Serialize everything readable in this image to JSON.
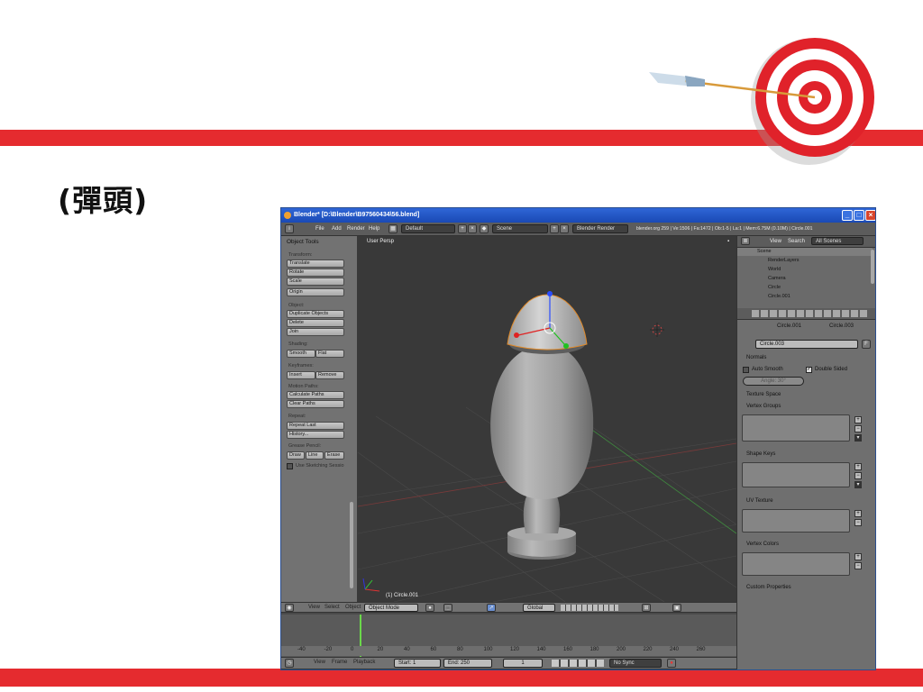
{
  "slide": {
    "heading": "(彈頭)",
    "colors": {
      "accent_red": "#e52b2f",
      "target_red": "#e0222a"
    }
  },
  "window": {
    "title": "Blender* [D:\\Blender\\B97560434\\56.blend]",
    "controls": {
      "minimize": "_",
      "maximize": "□",
      "close": "×"
    }
  },
  "menubar": {
    "menus": [
      "File",
      "Add",
      "Render",
      "Help"
    ],
    "screen_layout": "Default",
    "scene": "Scene",
    "render_engine": "Blender Render",
    "stats": "blender.org 259 | Ve:1506 | Fa:1472 | Ob:1-5 | La:1 | Mem:6.75M (0.10M) | Circle.001"
  },
  "tool_shelf": {
    "title": "Object Tools",
    "transform_label": "Transform:",
    "translate": "Translate",
    "rotate": "Rotate",
    "scale": "Scale",
    "origin": "Origin",
    "object_label": "Object:",
    "duplicate": "Duplicate Objects",
    "delete": "Delete",
    "join": "Join",
    "shading_label": "Shading:",
    "smooth": "Smooth",
    "flat": "Flat",
    "keyframes_label": "Keyframes:",
    "insert": "Insert",
    "remove": "Remove",
    "motion_label": "Motion Paths:",
    "calculate_paths": "Calculate Paths",
    "clear_paths": "Clear Paths",
    "repeat_label": "Repeat:",
    "repeat_last": "Repeat Last",
    "history": "History...",
    "grease_label": "Grease Pencil:",
    "draw": "Draw",
    "line": "Line",
    "erase": "Erase",
    "sketching": "Use Sketching Sessio"
  },
  "viewport": {
    "view_name": "User Persp",
    "object_label": "(1) Circle.001"
  },
  "viewport_header": {
    "menus": [
      "View",
      "Select",
      "Object"
    ],
    "mode": "Object Mode",
    "orientation": "Global"
  },
  "timeline": {
    "ticks": [
      "-40",
      "-20",
      "0",
      "20",
      "40",
      "60",
      "80",
      "100",
      "120",
      "140",
      "160",
      "180",
      "200",
      "220",
      "240",
      "260"
    ],
    "current_frame_tick": "0"
  },
  "timeline_header": {
    "menus": [
      "View",
      "Frame",
      "Playback"
    ],
    "start": "Start: 1",
    "end": "End: 250",
    "frame": "1",
    "sync": "No Sync"
  },
  "outliner": {
    "menus": [
      "View",
      "Search"
    ],
    "filter": "All Scenes",
    "items": [
      "Scene",
      "RenderLayers",
      "World",
      "Camera",
      "Circle",
      "Circle.001"
    ]
  },
  "properties": {
    "breadcrumb_object": "Circle.001",
    "breadcrumb_mesh": "Circle.003",
    "mesh_name": "Circle.003",
    "fake_user": "F",
    "normals": "Normals",
    "auto_smooth": "Auto Smooth",
    "double_sided": "Double Sided",
    "angle": "Angle: 30°",
    "texture_space": "Texture Space",
    "vertex_groups": "Vertex Groups",
    "shape_keys": "Shape Keys",
    "uv_texture": "UV Texture",
    "vertex_colors": "Vertex Colors",
    "custom_properties": "Custom Properties"
  }
}
